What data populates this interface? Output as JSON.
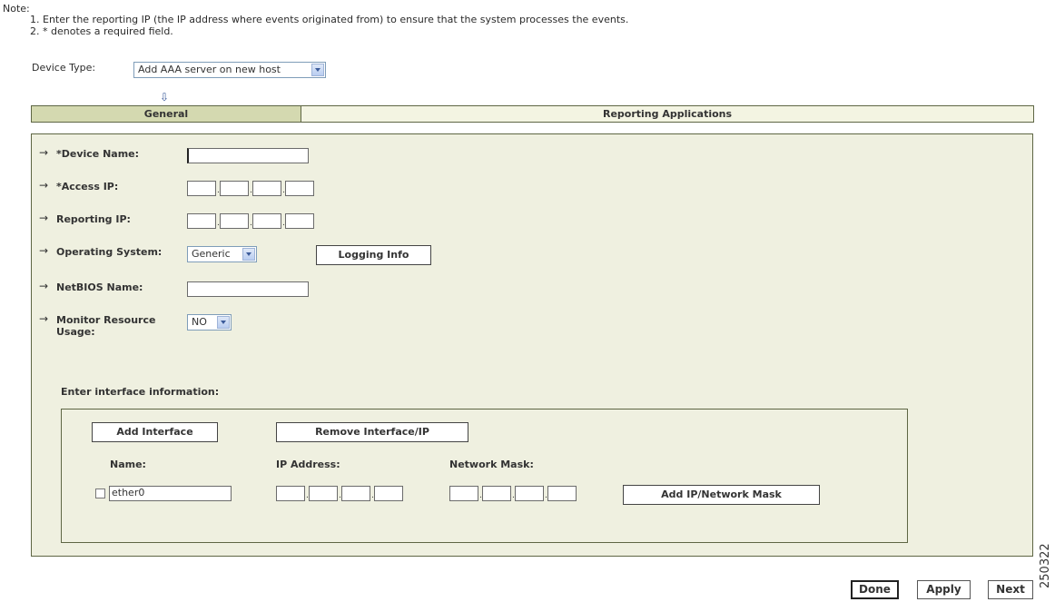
{
  "note": {
    "title": "Note:",
    "line1": "1. Enter the reporting IP (the IP address where events originated from) to ensure that the system processes the events.",
    "line2": "2. * denotes a required field."
  },
  "device_type": {
    "label": "Device Type:",
    "selected": "Add AAA server on new host"
  },
  "tabs": [
    {
      "label": "General",
      "active": true
    },
    {
      "label": "Reporting Applications",
      "active": false
    }
  ],
  "form": {
    "device_name_label": "*Device Name:",
    "device_name_value": "",
    "access_ip_label": "*Access IP:",
    "reporting_ip_label": "Reporting IP:",
    "os_label": "Operating System:",
    "os_selected": "Generic",
    "logging_info_button": "Logging Info",
    "netbios_label": "NetBIOS Name:",
    "netbios_value": "",
    "monitor_label_1": "Monitor Resource",
    "monitor_label_2": "Usage:",
    "monitor_selected": "NO"
  },
  "interfaces": {
    "heading": "Enter interface information:",
    "add_interface_button": "Add Interface",
    "remove_button": "Remove Interface/IP",
    "col_name": "Name:",
    "col_ip": "IP Address:",
    "col_mask": "Network Mask:",
    "rows": [
      {
        "name": "ether0",
        "checked": false
      }
    ],
    "add_ip_mask_button": "Add IP/Network Mask"
  },
  "footer": {
    "done": "Done",
    "apply": "Apply",
    "next": "Next"
  },
  "figure_id": "250322",
  "colors": {
    "panel_bg": "#eff0e0",
    "active_tab": "#d4d9b0",
    "border": "#5e6644"
  }
}
